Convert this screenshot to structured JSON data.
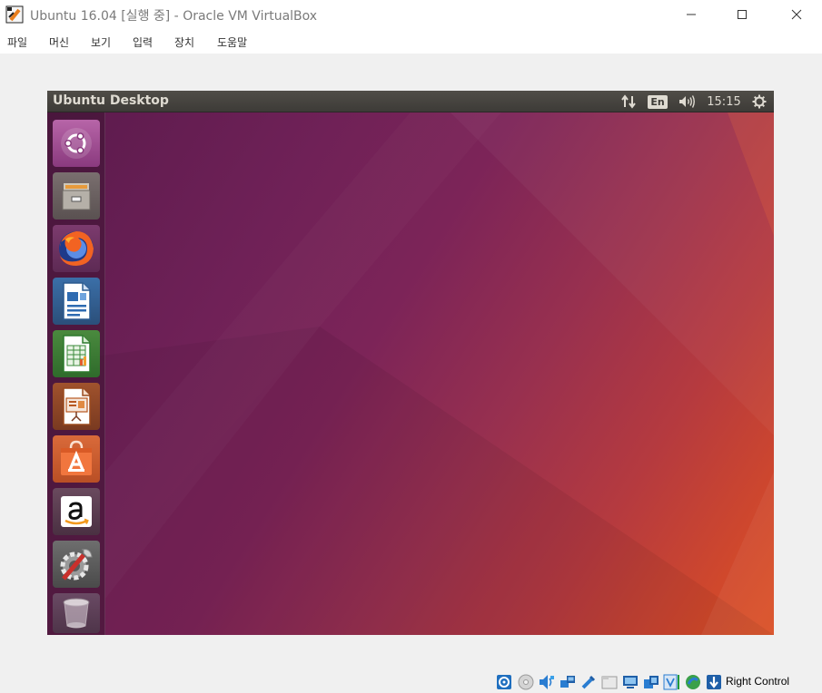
{
  "window": {
    "title": "Ubuntu 16.04 [실행 중] - Oracle VM VirtualBox"
  },
  "menu": {
    "items": [
      {
        "label": "파일"
      },
      {
        "label": "머신"
      },
      {
        "label": "보기"
      },
      {
        "label": "입력"
      },
      {
        "label": "장치"
      },
      {
        "label": "도움말"
      }
    ]
  },
  "guest": {
    "topbar_title": "Ubuntu Desktop",
    "keyboard_layout": "En",
    "clock": "15:15",
    "launcher": [
      {
        "name": "ubuntu-dash-icon"
      },
      {
        "name": "files-icon"
      },
      {
        "name": "firefox-icon"
      },
      {
        "name": "libreoffice-writer-icon"
      },
      {
        "name": "libreoffice-calc-icon"
      },
      {
        "name": "libreoffice-impress-icon"
      },
      {
        "name": "ubuntu-software-icon"
      },
      {
        "name": "amazon-icon"
      },
      {
        "name": "system-settings-icon"
      },
      {
        "name": "trash-icon"
      }
    ]
  },
  "statusbar": {
    "host_key": "Right Control"
  },
  "colors": {
    "desktop_purple": "#6f2157",
    "desktop_orange": "#db5024",
    "topbar": "#3d3b37"
  }
}
